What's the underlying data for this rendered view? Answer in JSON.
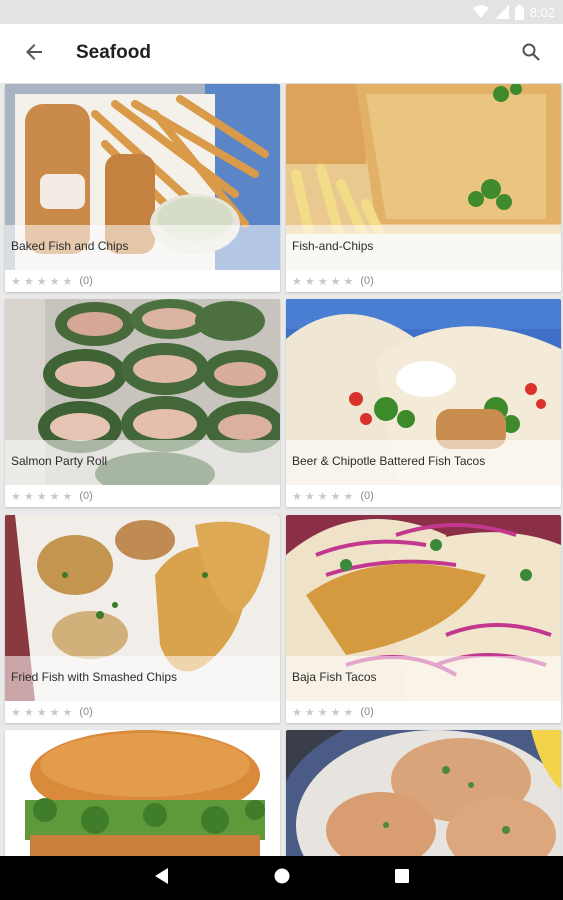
{
  "status": {
    "time": "8:02"
  },
  "header": {
    "title": "Seafood"
  },
  "cards": [
    {
      "title": "Baked Fish and Chips",
      "stars": "★★★★★",
      "count": "(0)"
    },
    {
      "title": "Fish-and-Chips",
      "stars": "★★★★★",
      "count": "(0)"
    },
    {
      "title": "Salmon Party Roll",
      "stars": "★★★★★",
      "count": "(0)"
    },
    {
      "title": "Beer & Chipotle Battered Fish Tacos",
      "stars": "★★★★★",
      "count": "(0)"
    },
    {
      "title": "Fried Fish with Smashed Chips",
      "stars": "★★★★★",
      "count": "(0)"
    },
    {
      "title": "Baja Fish Tacos",
      "stars": "★★★★★",
      "count": "(0)"
    },
    {
      "title": "",
      "stars": "",
      "count": ""
    },
    {
      "title": "",
      "stars": "",
      "count": ""
    }
  ],
  "colors": {
    "app_bar": "#ffffff",
    "status_bar": "#e3e3e3",
    "nav_bar": "#000000",
    "star_empty": "#c8c8c8"
  }
}
